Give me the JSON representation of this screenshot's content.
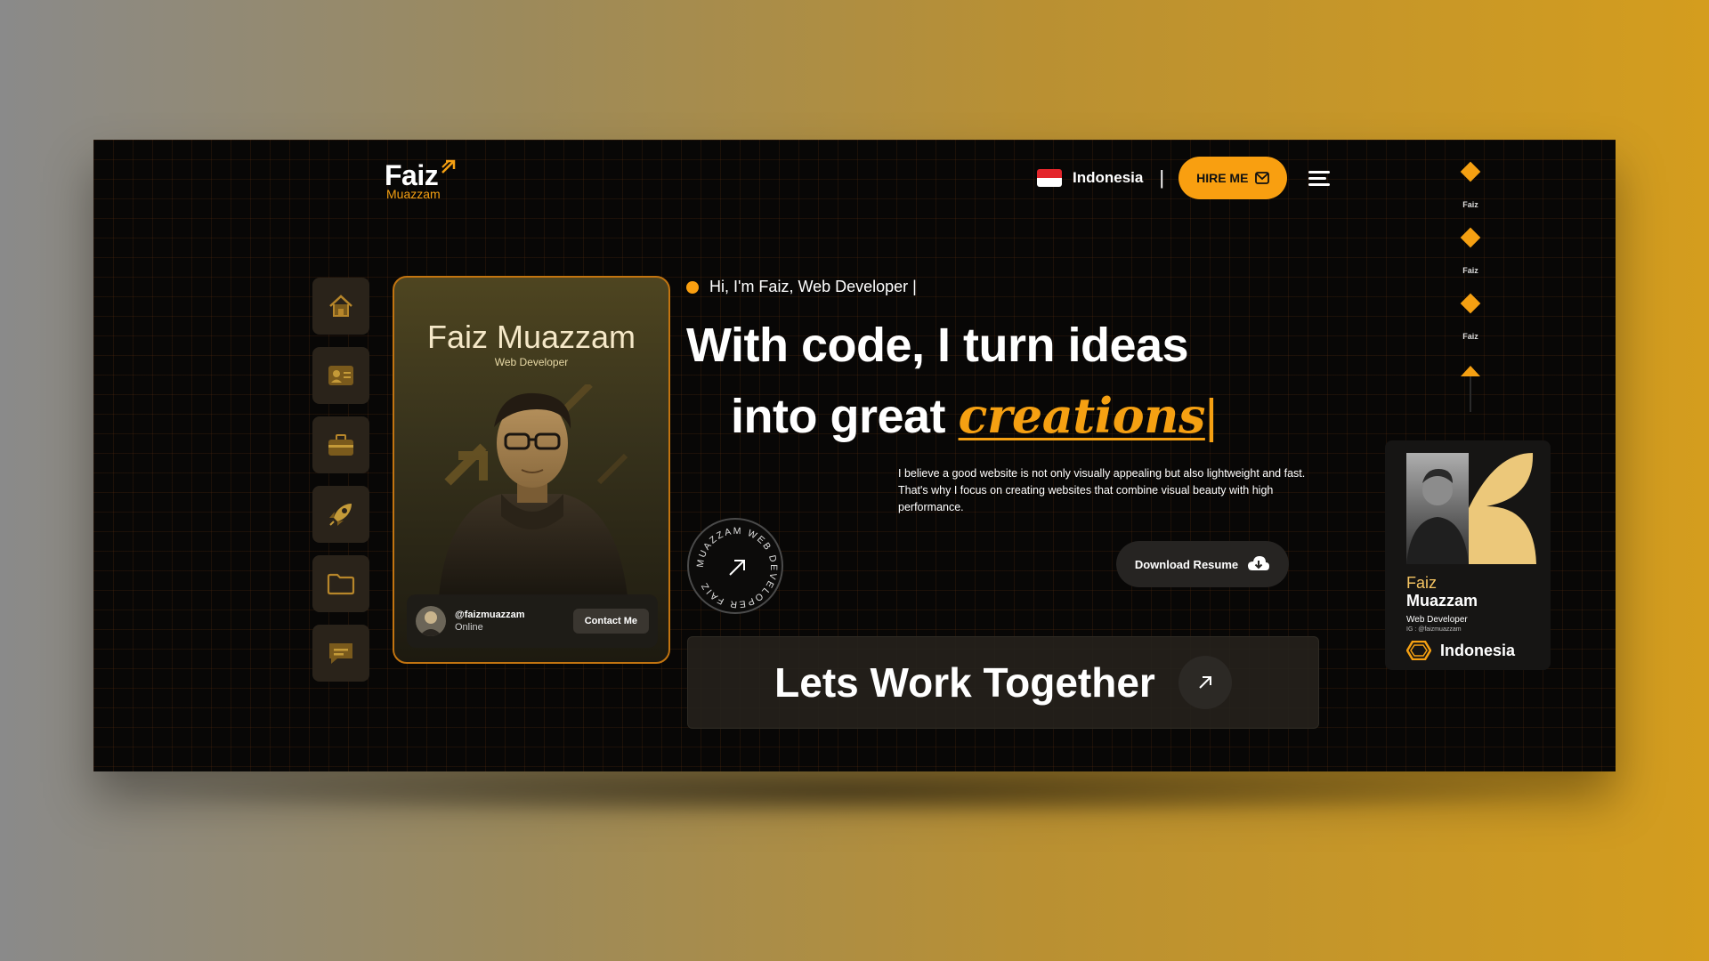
{
  "brand": {
    "name": "Faiz",
    "sub": "Muazzam"
  },
  "header": {
    "country": "Indonesia",
    "separator": "|",
    "hire_label": "HIRE ME"
  },
  "sidebar": {
    "items": [
      {
        "name": "home"
      },
      {
        "name": "about"
      },
      {
        "name": "experience"
      },
      {
        "name": "projects"
      },
      {
        "name": "portfolio"
      },
      {
        "name": "contact"
      }
    ]
  },
  "profile_card": {
    "name": "Faiz Muazzam",
    "role": "Web Developer",
    "handle": "@faizmuazzam",
    "status": "Online",
    "contact_label": "Contact Me"
  },
  "hero": {
    "greeting": "Hi, I'm Faiz, Web Developer |",
    "line1": "With code, I turn ideas",
    "line2_prefix": "into great",
    "line2_accent": "creations",
    "cursor": "|",
    "description": "I believe a good website is not only visually appealing but also lightweight and fast. That's why I focus on creating websites that combine visual beauty with high performance.",
    "circle_text": "MUAZZAM WEB DEVELOPER FAIZ",
    "download_label": "Download Resume",
    "cta_label": "Lets Work Together"
  },
  "id_card": {
    "first_name": "Faiz",
    "last_name": "Muazzam",
    "role": "Web Developer",
    "handle": "IG : @faizmuazzam",
    "country": "Indonesia"
  },
  "rail": {
    "mini_label": "Faiz"
  },
  "colors": {
    "accent": "#f99f10",
    "background": "#080706",
    "button_dark": "#262422"
  }
}
